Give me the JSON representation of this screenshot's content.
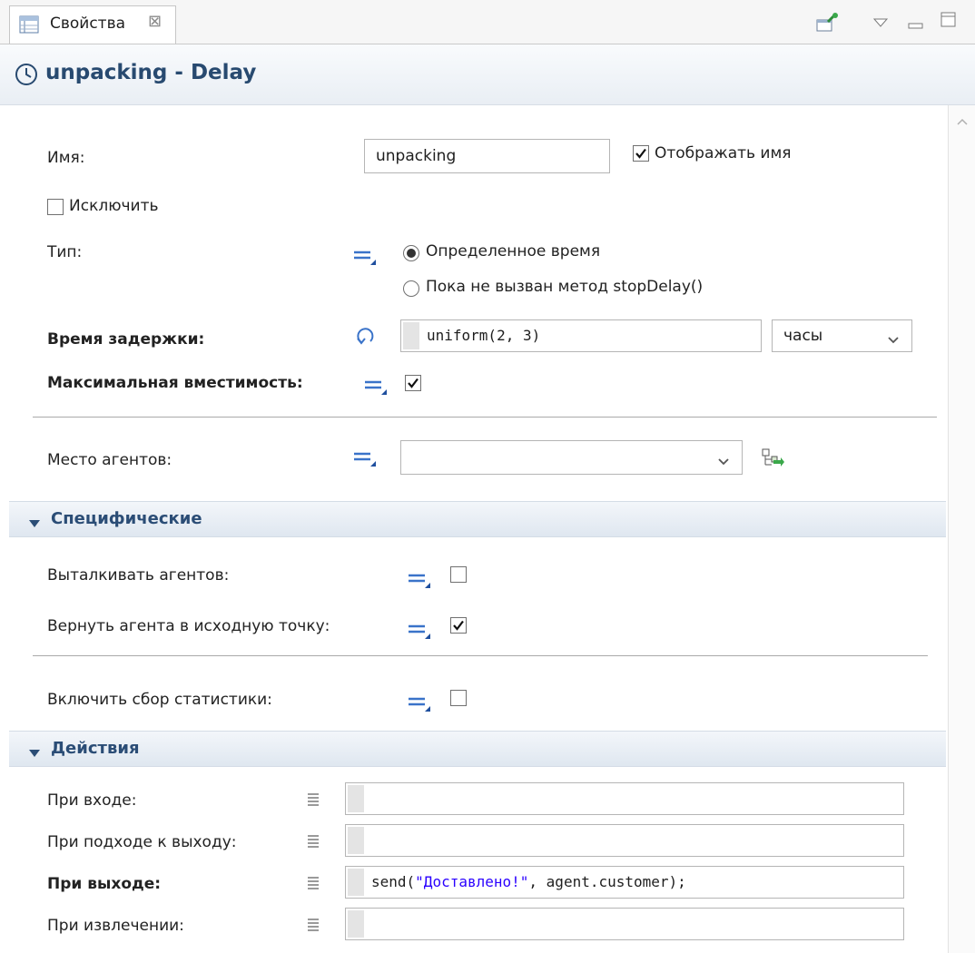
{
  "tab": {
    "label": "Свойства"
  },
  "header": {
    "title": "unpacking - Delay"
  },
  "general": {
    "name_label": "Имя:",
    "name_value": "unpacking",
    "show_name_label": "Отображать имя",
    "show_name_checked": true,
    "exclude_label": "Исключить",
    "exclude_checked": false,
    "type_label": "Тип:",
    "type_option_1": "Определенное время",
    "type_option_2": "Пока не вызван метод stopDelay()",
    "type_selected": 1,
    "delay_label": "Время задержки:",
    "delay_value": "uniform(2, 3)",
    "delay_unit": "часы",
    "max_capacity_label": "Максимальная вместимость:",
    "max_capacity_checked": true,
    "agent_location_label": "Место агентов:",
    "agent_location_value": ""
  },
  "specific": {
    "section_title": "Специфические",
    "push_agents_label": "Выталкивать агентов:",
    "push_agents_checked": false,
    "return_agent_label": "Вернуть агента в исходную точку:",
    "return_agent_checked": true,
    "collect_stats_label": "Включить сбор статистики:",
    "collect_stats_checked": false
  },
  "actions": {
    "section_title": "Действия",
    "on_enter_label": "При входе:",
    "on_enter_value": "",
    "on_at_exit_label": "При подходе к выходу:",
    "on_at_exit_value": "",
    "on_exit_label": "При выходе:",
    "on_exit_code_prefix": "send(",
    "on_exit_code_string": "\"Доставлено!\"",
    "on_exit_code_suffix": ", agent.customer);",
    "on_remove_label": "При извлечении:",
    "on_remove_value": ""
  },
  "colors": {
    "header_title": "#284a70",
    "section_title": "#2b4d76",
    "string_literal": "#2a00ff",
    "equals_icon": "#3a73c9"
  },
  "icons": [
    "properties-icon",
    "close-icon",
    "pin-icon",
    "view-menu-icon",
    "minimize-icon",
    "maximize-icon",
    "clock-icon",
    "static-value-icon",
    "dynamic-value-icon",
    "code-icon",
    "location-picker-icon",
    "dropdown-arrow-icon",
    "collapse-triangle-icon",
    "scroll-up-icon"
  ]
}
